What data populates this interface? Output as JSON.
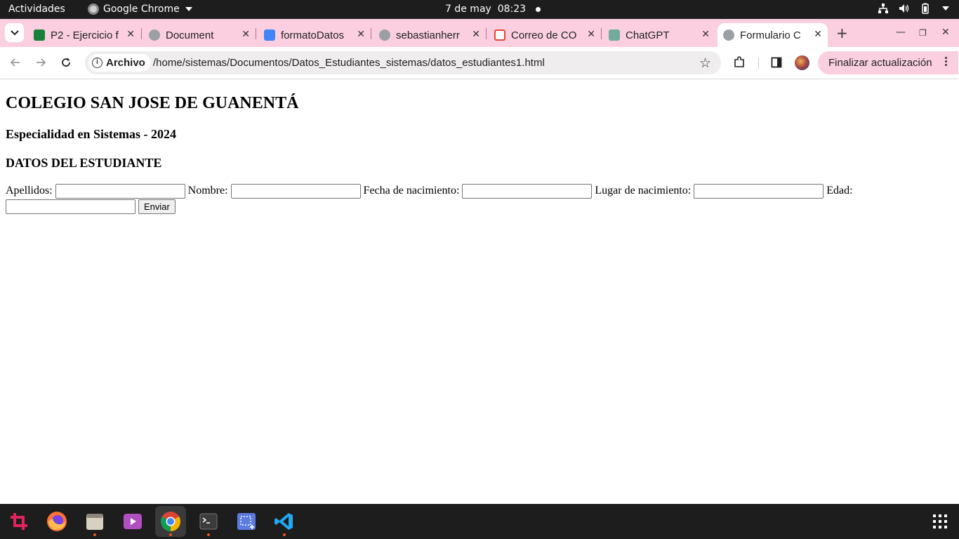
{
  "topbar": {
    "activities": "Actividades",
    "app_name": "Google Chrome",
    "clock": "7 de may  08:23"
  },
  "tabs": [
    {
      "title": "P2 - Ejercicio f",
      "favicon_color": "#188038",
      "icon": "classroom-icon"
    },
    {
      "title": "Document",
      "favicon_color": "#9aa0a6",
      "icon": "globe-icon"
    },
    {
      "title": "formatoDatos",
      "favicon_color": "#4285f4",
      "icon": "docs-icon"
    },
    {
      "title": "sebastianherr",
      "favicon_color": "#9aa0a6",
      "icon": "github-icon"
    },
    {
      "title": "Correo de CO",
      "favicon_color": "#ea4335",
      "icon": "gmail-icon"
    },
    {
      "title": "ChatGPT",
      "favicon_color": "#74aa9c",
      "icon": "chatgpt-icon"
    },
    {
      "title": "Formulario C",
      "favicon_color": "#9aa0a6",
      "icon": "globe-icon",
      "active": true
    }
  ],
  "toolbar": {
    "chip_label": "Archivo",
    "url": "/home/sistemas/Documentos/Datos_Estudiantes_sistemas/datos_estudiantes1.html",
    "update_button": "Finalizar actualización"
  },
  "page": {
    "heading": "COLEGIO SAN JOSE DE GUANENTÁ",
    "subheading": "Especialidad en Sistemas - 2024",
    "section": "DATOS DEL ESTUDIANTE",
    "fields": {
      "apellidos": "Apellidos:",
      "nombre": "Nombre:",
      "fecha": "Fecha de nacimiento:",
      "lugar": "Lugar de nacimiento:",
      "edad": "Edad:"
    },
    "submit": "Enviar"
  },
  "colors": {
    "tabstrip_bg": "#fbcfe0",
    "topbar_bg": "#1d1d1d",
    "accent_running": "#e95420"
  },
  "dock": [
    "screenshot-tool-icon",
    "firefox-icon",
    "files-icon",
    "video-player-icon",
    "chrome-icon",
    "terminal-icon",
    "screen-capture-icon",
    "vscode-icon"
  ]
}
